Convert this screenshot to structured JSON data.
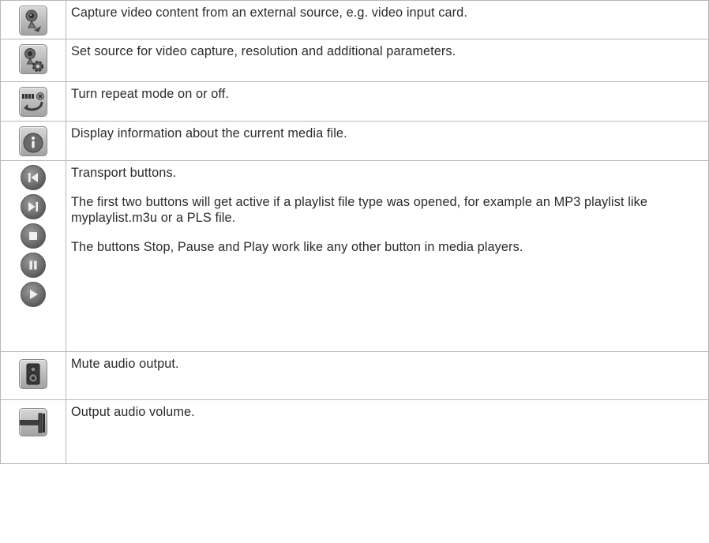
{
  "rows": [
    {
      "icon": "webcam-capture-icon",
      "lines": [
        "Capture video content from an external source, e.g. video input card."
      ]
    },
    {
      "icon": "webcam-settings-icon",
      "lines": [
        "Set source for video capture, resolution and additional parameters."
      ]
    },
    {
      "icon": "repeat-icon",
      "lines": [
        "Turn repeat mode on or off."
      ]
    },
    {
      "icon": "info-icon",
      "lines": [
        "Display information about the current media file."
      ]
    },
    {
      "icons": [
        "previous-icon",
        "next-icon",
        "stop-icon",
        "pause-icon",
        "play-icon"
      ],
      "lines": [
        "Transport buttons.",
        "The first two buttons will get active if a playlist file type was opened, for example an MP3 playlist like myplaylist.m3u or a PLS file.",
        "The buttons Stop, Pause and Play work like any other button in media players."
      ]
    },
    {
      "icon": "speaker-icon",
      "lines": [
        "Mute audio output."
      ]
    },
    {
      "icon": "volume-slider-icon",
      "lines": [
        "Output audio volume."
      ]
    }
  ]
}
